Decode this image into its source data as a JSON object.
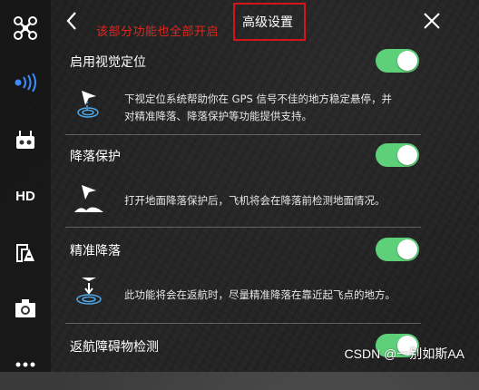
{
  "header": {
    "title": "高级设置",
    "annotation": "该部分功能也全部开启"
  },
  "sidebar": {
    "items": [
      {
        "icon": "drone-icon"
      },
      {
        "icon": "signal-icon",
        "active": true
      },
      {
        "icon": "remote-controller-icon"
      },
      {
        "icon": "hd-icon",
        "label": "HD"
      },
      {
        "icon": "flight-mode-icon"
      },
      {
        "icon": "camera-icon"
      },
      {
        "icon": "more-icon"
      }
    ]
  },
  "settings": [
    {
      "title": "启用视觉定位",
      "enabled": true,
      "desc_line1": "下视定位系统帮助你在 GPS 信号不佳的地方稳定悬停，并",
      "desc_line2": "对精准降落、降落保护等功能提供支持。"
    },
    {
      "title": "降落保护",
      "enabled": true,
      "desc_line1": "打开地面降落保护后，飞机将会在降落前检测地面情况。"
    },
    {
      "title": "精准降落",
      "enabled": true,
      "desc_line1": "此功能将会在返航时，尽量精准降落在靠近起飞点的地方。"
    },
    {
      "title": "返航障碍物检测",
      "enabled": true
    }
  ],
  "watermark": "CSDN @一别如斯AA"
}
